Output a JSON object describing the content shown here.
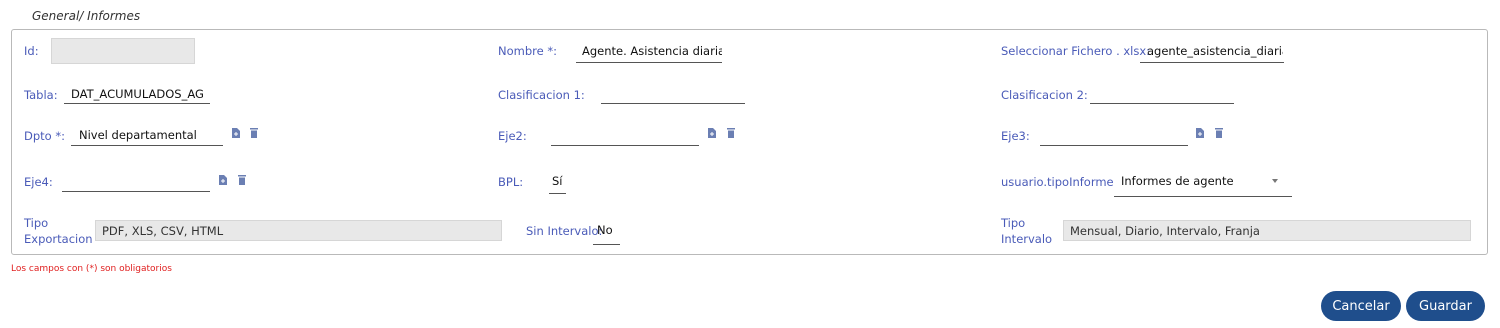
{
  "breadcrumb": "General/ Informes",
  "fields": {
    "id": {
      "label": "Id:",
      "value": ""
    },
    "nombre": {
      "label": "Nombre *:",
      "value": "Agente. Asistencia diaria"
    },
    "fichero": {
      "label": "Seleccionar Fichero . xlsx:",
      "value": "agente_asistencia_diaria"
    },
    "tabla": {
      "label": "Tabla:",
      "value": "DAT_ACUMULADOS_AGEN"
    },
    "clasificacion1": {
      "label": "Clasificacion 1:",
      "value": ""
    },
    "clasificacion2": {
      "label": "Clasificacion 2:",
      "value": ""
    },
    "dpto": {
      "label": "Dpto *:",
      "value": "Nivel departamental"
    },
    "eje2": {
      "label": "Eje2:",
      "value": ""
    },
    "eje3": {
      "label": "Eje3:",
      "value": ""
    },
    "eje4": {
      "label": "Eje4:",
      "value": ""
    },
    "bpl": {
      "label": "BPL:",
      "value": "Sí"
    },
    "tipoInforme": {
      "label": "usuario.tipoInforme",
      "value": "Informes de agente"
    },
    "tipoExportacion": {
      "label_line1": "Tipo",
      "label_line2": "Exportacion",
      "value": "PDF, XLS, CSV, HTML"
    },
    "sinIntervalo": {
      "label": "Sin Intervalo:",
      "value": "No"
    },
    "tipoIntervalo": {
      "label_line1": "Tipo",
      "label_line2": "Intervalo",
      "value": "Mensual, Diario, Intervalo, Franja"
    }
  },
  "required_note": "Los campos con (*) son obligatorios",
  "buttons": {
    "cancel": "Cancelar",
    "save": "Guardar"
  },
  "icons": {
    "add": "file-add-icon",
    "delete": "trash-icon",
    "dropdown": "chevron-down-icon"
  },
  "colors": {
    "label": "#4a5bb8",
    "button": "#1f4e8c",
    "required": "#e02020"
  }
}
